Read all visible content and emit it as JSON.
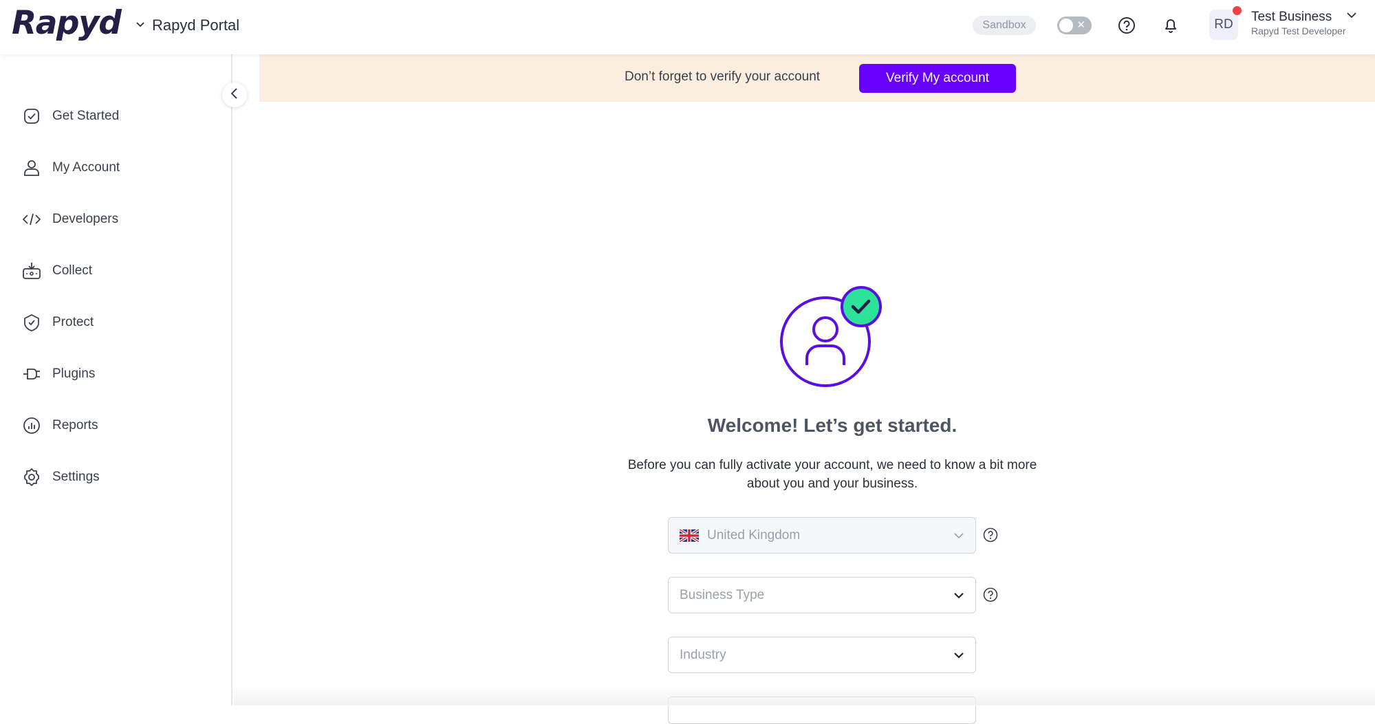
{
  "header": {
    "logo": "Rapyd",
    "portal_switcher": "Rapyd Portal",
    "environment_badge": "Sandbox",
    "avatar_initials": "RD",
    "user_name": "Test Business",
    "user_role": "Rapyd Test Developer"
  },
  "sidebar": {
    "items": [
      {
        "label": "Get Started",
        "icon": "check-badge-icon"
      },
      {
        "label": "My Account",
        "icon": "user-icon"
      },
      {
        "label": "Developers",
        "icon": "code-icon"
      },
      {
        "label": "Collect",
        "icon": "collect-icon"
      },
      {
        "label": "Protect",
        "icon": "shield-icon"
      },
      {
        "label": "Plugins",
        "icon": "plug-icon"
      },
      {
        "label": "Reports",
        "icon": "chart-icon"
      },
      {
        "label": "Settings",
        "icon": "gear-icon"
      }
    ]
  },
  "banner": {
    "text": "Don’t forget to verify your account",
    "button_label": "Verify My account"
  },
  "main": {
    "title": "Welcome! Let’s get started.",
    "description": "Before you can fully activate your account, we need to know a bit more about you and your business.",
    "country_select": "United Kingdom",
    "business_type_placeholder": "Business Type",
    "industry_placeholder": "Industry"
  },
  "colors": {
    "brand_purple": "#6800ff",
    "success_green": "#2de39a",
    "banner_bg": "#fbeedf",
    "notification_red": "#ef4444"
  }
}
